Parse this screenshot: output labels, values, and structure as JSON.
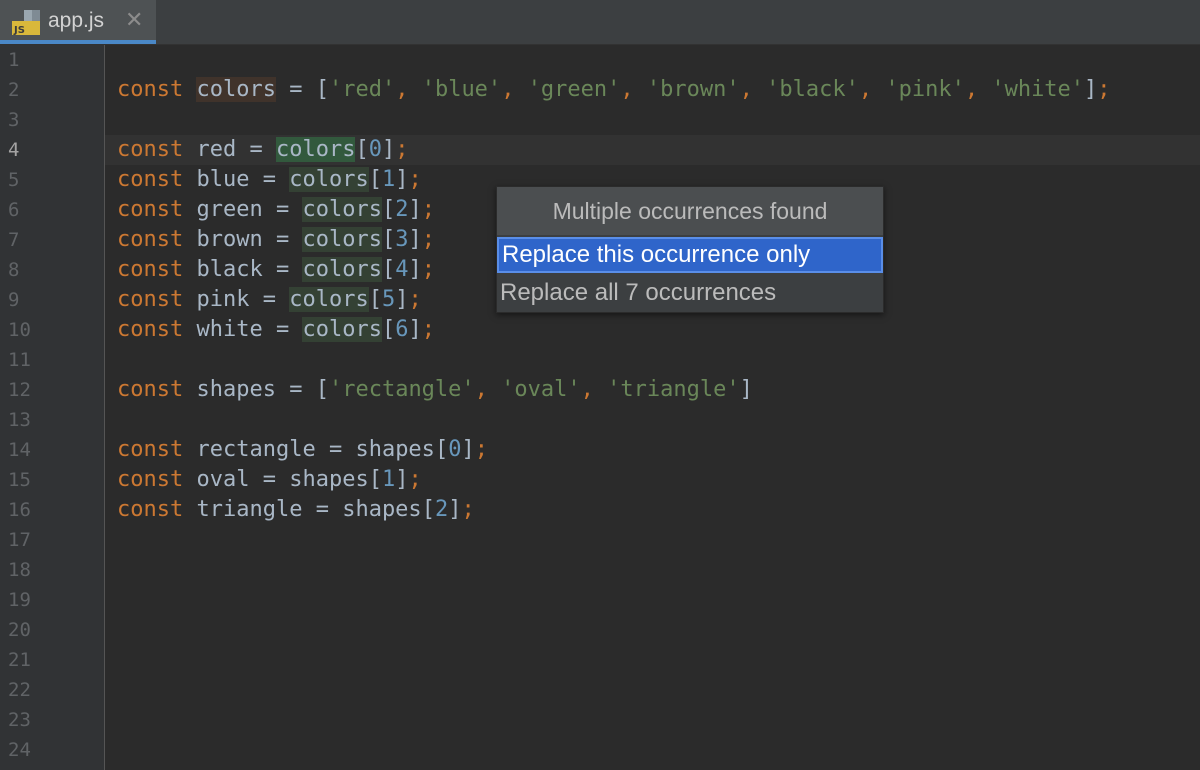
{
  "tab": {
    "icon": "javascript-file-icon",
    "icon_text": "JS",
    "filename": "app.js",
    "close": "✕"
  },
  "gutter": {
    "current_line": 4,
    "line_numbers": [
      "1",
      "2",
      "3",
      "4",
      "5",
      "6",
      "7",
      "8",
      "9",
      "10",
      "11",
      "12",
      "13",
      "14",
      "15",
      "16",
      "17",
      "18",
      "19",
      "20",
      "21",
      "22",
      "23",
      "24"
    ]
  },
  "code": {
    "line2": {
      "kw": "const",
      "name": "colors",
      "eq": " = ",
      "open": "[",
      "items": [
        "'red'",
        "'blue'",
        "'green'",
        "'brown'",
        "'black'",
        "'pink'",
        "'white'"
      ],
      "sep": ", ",
      "close": "]",
      "semi": ";"
    },
    "color_lines": [
      {
        "kw": "const",
        "name": "red",
        "eq": " = ",
        "ref": "colors",
        "open": "[",
        "idx": "0",
        "close": "]",
        "semi": ";"
      },
      {
        "kw": "const",
        "name": "blue",
        "eq": " = ",
        "ref": "colors",
        "open": "[",
        "idx": "1",
        "close": "]",
        "semi": ";"
      },
      {
        "kw": "const",
        "name": "green",
        "eq": " = ",
        "ref": "colors",
        "open": "[",
        "idx": "2",
        "close": "]",
        "semi": ";"
      },
      {
        "kw": "const",
        "name": "brown",
        "eq": " = ",
        "ref": "colors",
        "open": "[",
        "idx": "3",
        "close": "]",
        "semi": ";"
      },
      {
        "kw": "const",
        "name": "black",
        "eq": " = ",
        "ref": "colors",
        "open": "[",
        "idx": "4",
        "close": "]",
        "semi": ";"
      },
      {
        "kw": "const",
        "name": "pink",
        "eq": " = ",
        "ref": "colors",
        "open": "[",
        "idx": "5",
        "close": "]",
        "semi": ";"
      },
      {
        "kw": "const",
        "name": "white",
        "eq": " = ",
        "ref": "colors",
        "open": "[",
        "idx": "6",
        "close": "]",
        "semi": ";"
      }
    ],
    "line12": {
      "kw": "const",
      "name": "shapes",
      "eq": " = ",
      "open": "[",
      "items": [
        "'rectangle'",
        "'oval'",
        "'triangle'"
      ],
      "sep": ", ",
      "close": "]"
    },
    "shape_lines": [
      {
        "kw": "const",
        "name": "rectangle",
        "eq": " = ",
        "ref": "shapes",
        "open": "[",
        "idx": "0",
        "close": "]",
        "semi": ";"
      },
      {
        "kw": "const",
        "name": "oval",
        "eq": " = ",
        "ref": "shapes",
        "open": "[",
        "idx": "1",
        "close": "]",
        "semi": ";"
      },
      {
        "kw": "const",
        "name": "triangle",
        "eq": " = ",
        "ref": "shapes",
        "open": "[",
        "idx": "2",
        "close": "]",
        "semi": ";"
      }
    ]
  },
  "popup": {
    "title": "Multiple occurrences found",
    "options": [
      "Replace this occurrence only",
      "Replace all 7 occurrences"
    ],
    "selected_index": 0
  },
  "colors": {
    "background": "#2b2b2b",
    "gutter": "#313335",
    "keyword": "#cc7832",
    "string": "#6a8759",
    "number": "#6897bb",
    "text": "#a9b7c6",
    "selection": "#2f65ca"
  }
}
